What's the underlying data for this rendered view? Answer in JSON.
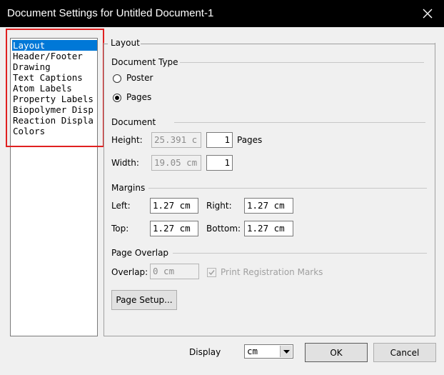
{
  "window": {
    "title": "Document Settings for Untitled Document-1"
  },
  "sidebar": {
    "items": [
      {
        "label": "Layout",
        "selected": true
      },
      {
        "label": "Header/Footer"
      },
      {
        "label": "Drawing"
      },
      {
        "label": "Text Captions"
      },
      {
        "label": "Atom Labels"
      },
      {
        "label": "Property Labels"
      },
      {
        "label": "Biopolymer Disp"
      },
      {
        "label": "Reaction Displa"
      },
      {
        "label": "Colors"
      }
    ]
  },
  "panel": {
    "title": "Layout",
    "document_type": {
      "title": "Document Type",
      "options": [
        {
          "label": "Poster",
          "selected": false
        },
        {
          "label": "Pages",
          "selected": true
        }
      ]
    },
    "document": {
      "title": "Document",
      "height_label": "Height:",
      "height_value": "25.391 c",
      "height_pages": "1",
      "pages_label": "Pages",
      "width_label": "Width:",
      "width_value": "19.05 cm",
      "width_pages": "1"
    },
    "margins": {
      "title": "Margins",
      "left_label": "Left:",
      "left_value": "1.27 cm",
      "right_label": "Right:",
      "right_value": "1.27 cm",
      "top_label": "Top:",
      "top_value": "1.27 cm",
      "bottom_label": "Bottom:",
      "bottom_value": "1.27 cm"
    },
    "page_overlap": {
      "title": "Page Overlap",
      "overlap_label": "Overlap:",
      "overlap_value": "0 cm",
      "print_reg_label": "Print Registration Marks",
      "print_reg_checked": true
    },
    "page_setup_label": "Page Setup..."
  },
  "footer": {
    "display_label": "Display",
    "display_value": "cm",
    "ok_label": "OK",
    "cancel_label": "Cancel"
  },
  "colors": {
    "titlebar": "#000000",
    "selection": "#0078d7",
    "highlight": "#e02020"
  }
}
